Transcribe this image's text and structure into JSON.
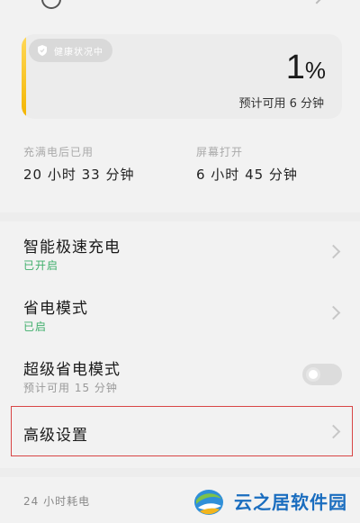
{
  "header": {
    "partial_text": ""
  },
  "battery": {
    "health_badge": "健康状况中",
    "percent_value": "1",
    "percent_unit": "%",
    "remaining": "预计可用 6 分钟",
    "level": 0.01
  },
  "stats": [
    {
      "label": "充满电后已用",
      "value": "20 小时 33 分钟"
    },
    {
      "label": "屏幕打开",
      "value": "6 小时 45 分钟"
    }
  ],
  "settings": [
    {
      "title": "智能极速充电",
      "subtitle": "已开启",
      "control": "chevron"
    },
    {
      "title": "省电模式",
      "subtitle": "已启",
      "control": "chevron"
    },
    {
      "title": "超级省电模式",
      "subtitle": "预计可用 15 分钟",
      "control": "toggle",
      "toggle_on": false
    },
    {
      "title": "高级设置",
      "subtitle": "",
      "control": "chevron"
    }
  ],
  "bottom": {
    "label": "24 小时耗电"
  },
  "watermark": {
    "text": "云之居软件园"
  },
  "colors": {
    "accent_yellow": "#f3b400",
    "enabled_green": "#3fae6b",
    "highlight_red": "#d84545"
  }
}
